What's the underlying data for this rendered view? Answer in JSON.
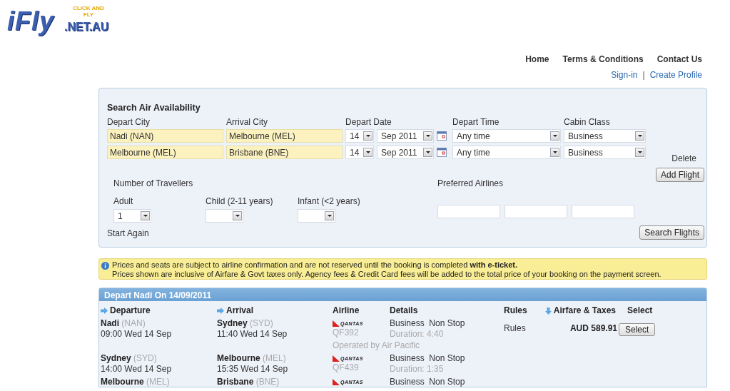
{
  "logo": {
    "name": "iFly",
    "domain": ".NET.AU",
    "slogan": "CLICK AND FLY"
  },
  "nav": [
    {
      "label": "Home"
    },
    {
      "label": "Terms & Conditions"
    },
    {
      "label": "Contact Us"
    }
  ],
  "account_links": [
    {
      "label": "Sign-in"
    },
    {
      "label": "Create Profile"
    }
  ],
  "account_separator": "|",
  "search": {
    "title": "Search Air Availability",
    "columns": [
      "Depart City",
      "Arrival City",
      "Depart Date",
      "Depart Time",
      "Cabin Class"
    ],
    "legs": [
      {
        "depart_city": "Nadi (NAN)",
        "arrival_city": "Melbourne (MEL)",
        "day": "14",
        "month": "Sep 2011",
        "time": "Any time",
        "cabin": "Business"
      },
      {
        "depart_city": "Melbourne (MEL)",
        "arrival_city": "Brisbane (BNE)",
        "day": "14",
        "month": "Sep 2011",
        "time": "Any time",
        "cabin": "Business",
        "delete": "Delete"
      }
    ],
    "add_flight": "Add Flight",
    "travellers": {
      "title": "Number of Travellers",
      "fields": [
        {
          "label": "Adult",
          "value": "1"
        },
        {
          "label": "Child (2-11 years)"
        },
        {
          "label": "Infant (<2 years)"
        }
      ]
    },
    "preferred_airlines": "Preferred Airlines",
    "start_again": "Start Again",
    "search_button": "Search Flights"
  },
  "notice": {
    "lines": [
      "Prices and seats are subject to airline confirmation and are not reserved until the booking is completed **with e-ticket.**",
      "Prices shown are inclusive of Airfare & Govt taxes only. Agency fees & Credit Card fees will be added to the total price of your booking on the payment screen."
    ]
  },
  "results": {
    "title": "Depart Nadi On 14/09/2011",
    "columns": [
      {
        "label": "Departure"
      },
      {
        "label": "Arrival"
      },
      {
        "label": "Airline"
      },
      {
        "label": "Details"
      },
      {
        "label": "Rules"
      },
      {
        "label": "Airfare & Taxes"
      },
      {
        "label": "Select"
      }
    ],
    "legs": [
      {
        "depart_city": "Nadi",
        "depart_code": "(NAN)",
        "depart_time": "09:00 Wed 14 Sep",
        "arrive_city": "Sydney",
        "arrive_code": "(SYD)",
        "arrive_time": "11:40 Wed 14 Sep",
        "airline_logo": "QANTAS",
        "flight_no": "QF392",
        "operated_by": "Operated by Air Pacific",
        "cabin": "Business",
        "stops": "Non Stop",
        "duration": "Duration: 4:40"
      },
      {
        "depart_city": "Sydney",
        "depart_code": "(SYD)",
        "depart_time": "14:00 Wed 14 Sep",
        "arrive_city": "Melbourne",
        "arrive_code": "(MEL)",
        "arrive_time": "15:35 Wed 14 Sep",
        "airline_logo": "QANTAS",
        "flight_no": "QF439",
        "cabin": "Business",
        "stops": "Non Stop",
        "duration": "Duration: 1:35"
      },
      {
        "depart_city": "Melbourne",
        "depart_code": "(MEL)",
        "arrive_city": "Brisbane",
        "arrive_code": "(BNE)",
        "airline_logo": "QANTAS",
        "cabin": "Business",
        "stops": "Non Stop"
      }
    ],
    "fare": {
      "rules": "Rules",
      "price": "AUD 589.91",
      "select": "Select"
    }
  }
}
